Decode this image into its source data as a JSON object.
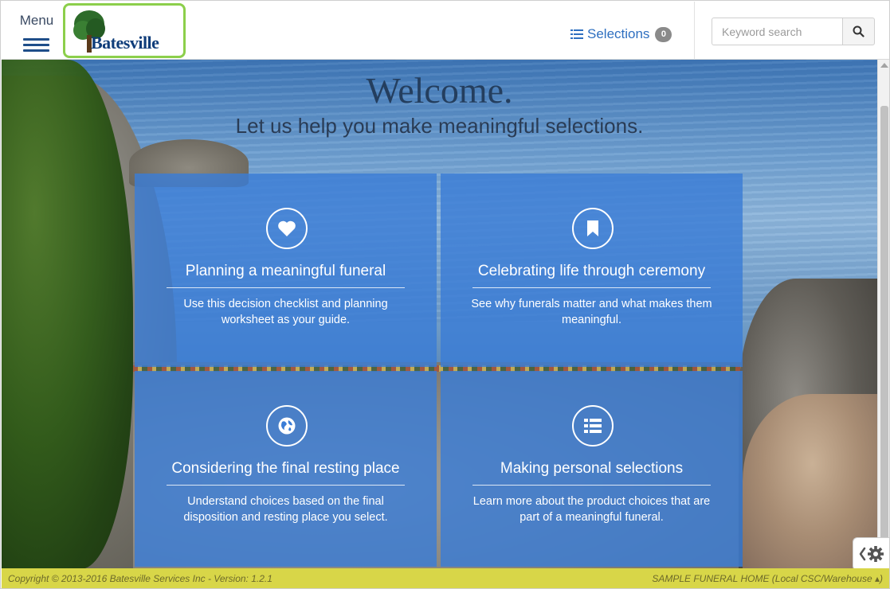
{
  "header": {
    "menu_label": "Menu",
    "logo_text": "Batesville",
    "selections_label": "Selections",
    "selections_count": "0",
    "search_placeholder": "Keyword search"
  },
  "hero": {
    "heading": "Welcome.",
    "tagline": "Let us help you make meaningful selections."
  },
  "tiles": [
    {
      "icon": "heart-icon",
      "title": "Planning a meaningful funeral",
      "description": "Use this decision checklist and planning worksheet as your guide."
    },
    {
      "icon": "bookmark-icon",
      "title": "Celebrating life through ceremony",
      "description": "See why funerals matter and what makes them meaningful."
    },
    {
      "icon": "globe-icon",
      "title": "Considering the final resting place",
      "description": "Understand choices based on the final disposition and resting place you select."
    },
    {
      "icon": "list-icon",
      "title": "Making personal selections",
      "description": "Learn more about the product choices that are part of a meaningful funeral."
    }
  ],
  "footer": {
    "copyright": "Copyright © 2013-2016 Batesville Services Inc - Version: 1.2.1",
    "location": "SAMPLE FUNERAL HOME (Local CSC/Warehouse ▴)"
  },
  "colors": {
    "logo_border": "#8ccf4b",
    "tile_bg": "#3a7cd6",
    "link_blue": "#2e6fc0",
    "footer_bg": "#d8d648"
  }
}
